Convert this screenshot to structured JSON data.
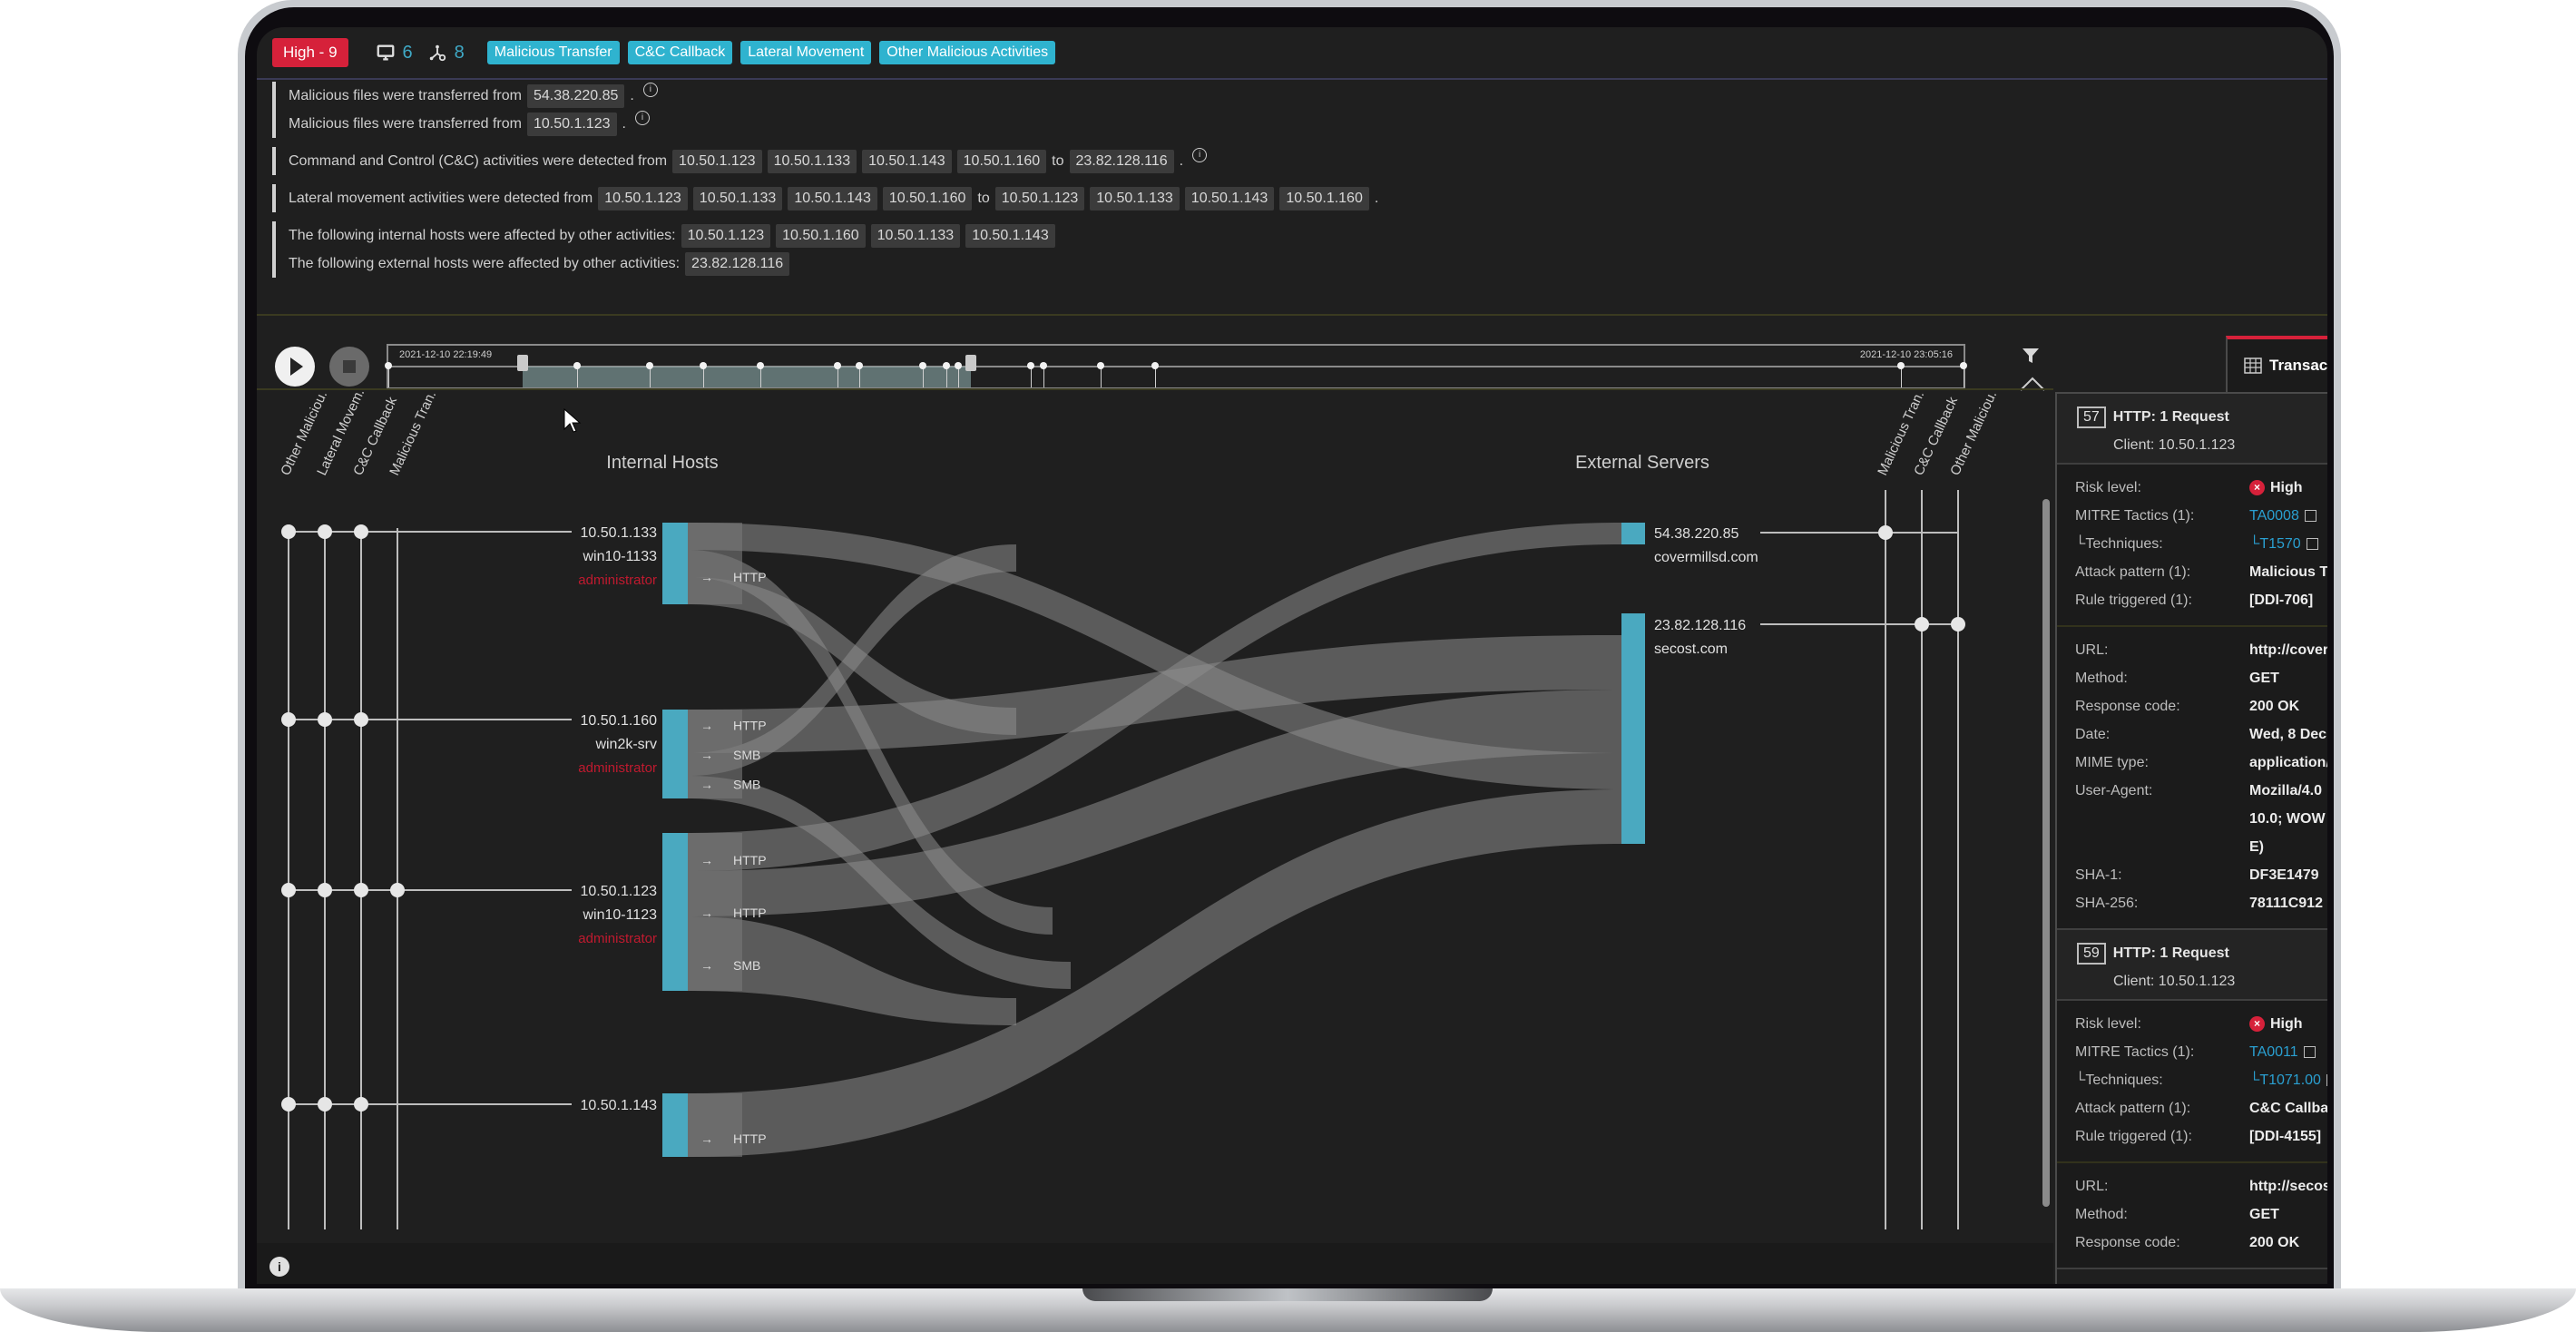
{
  "header": {
    "severity_badge": "High - 9",
    "hosts_count": "6",
    "connections_count": "8",
    "tags": [
      "Malicious Transfer",
      "C&C Callback",
      "Lateral Movement",
      "Other Malicious Activities"
    ]
  },
  "summary": {
    "transfer": [
      {
        "text": "Malicious files were transferred from",
        "ips": [
          "54.38.220.85"
        ],
        "suffix": "."
      },
      {
        "text": "Malicious files were transferred from",
        "ips": [
          "10.50.1.123"
        ],
        "suffix": "."
      }
    ],
    "cnc": {
      "text": "Command and Control (C&C) activities were detected from",
      "from": [
        "10.50.1.123",
        "10.50.1.133",
        "10.50.1.143",
        "10.50.1.160"
      ],
      "to_word": "to",
      "to": [
        "23.82.128.116"
      ],
      "suffix": "."
    },
    "lateral": {
      "text": "Lateral movement activities were detected from",
      "from": [
        "10.50.1.123",
        "10.50.1.133",
        "10.50.1.143",
        "10.50.1.160"
      ],
      "to_word": "to",
      "to": [
        "10.50.1.123",
        "10.50.1.133",
        "10.50.1.143",
        "10.50.1.160"
      ],
      "suffix": "."
    },
    "other_internal": {
      "text": "The following internal hosts were affected by other activities:",
      "ips": [
        "10.50.1.123",
        "10.50.1.160",
        "10.50.1.133",
        "10.50.1.143"
      ]
    },
    "other_external": {
      "text": "The following external hosts were affected by other activities:",
      "ips": [
        "23.82.128.116"
      ]
    }
  },
  "timeline": {
    "start_label": "2021-12-10 22:19:49",
    "end_label": "2021-12-10 23:05:16",
    "selected_range": [
      0.085,
      0.37
    ],
    "event_positions": [
      0.0,
      0.12,
      0.166,
      0.2,
      0.236,
      0.285,
      0.299,
      0.339,
      0.354,
      0.362,
      0.408,
      0.416,
      0.452,
      0.487,
      0.96,
      1.0
    ]
  },
  "graph": {
    "left_column_title": "Internal Hosts",
    "right_column_title": "External Servers",
    "left_category_labels": [
      "Other Maliciou.",
      "Lateral Movem.",
      "C&C Callback",
      "Malicious Tran."
    ],
    "right_category_labels": [
      "Malicious Tran.",
      "C&C Callback",
      "Other Maliciou."
    ],
    "internal_hosts": [
      {
        "ip": "10.50.1.133",
        "hostname": "win10-1133",
        "user": "administrator",
        "categories": [
          true,
          true,
          true,
          false
        ],
        "protocols": [
          "HTTP"
        ]
      },
      {
        "ip": "10.50.1.160",
        "hostname": "win2k-srv",
        "user": "administrator",
        "categories": [
          true,
          true,
          true,
          false
        ],
        "protocols": [
          "HTTP",
          "SMB",
          "SMB"
        ]
      },
      {
        "ip": "10.50.1.123",
        "hostname": "win10-1123",
        "user": "administrator",
        "categories": [
          true,
          true,
          true,
          true
        ],
        "protocols": [
          "HTTP",
          "HTTP",
          "SMB"
        ]
      },
      {
        "ip": "10.50.1.143",
        "hostname": "",
        "user": "",
        "categories": [
          true,
          true,
          true,
          false
        ],
        "protocols": [
          "HTTP"
        ]
      }
    ],
    "external_servers": [
      {
        "ip": "54.38.220.85",
        "domain": "covermillsd.com",
        "categories": [
          true,
          false,
          false
        ]
      },
      {
        "ip": "23.82.128.116",
        "domain": "secost.com",
        "categories": [
          false,
          true,
          true
        ]
      }
    ]
  },
  "side_panel": {
    "tab_label": "Transac",
    "cards": [
      {
        "number": "57",
        "title": "HTTP: 1 Request",
        "client": "Client: 10.50.1.123",
        "risk": [
          {
            "k": "Risk level:",
            "v": "High",
            "type": "risk"
          },
          {
            "k": "MITRE Tactics (1):",
            "v": "TA0008",
            "type": "link"
          },
          {
            "k": "└Techniques:",
            "v": "└T1570",
            "type": "link"
          },
          {
            "k": "Attack pattern (1):",
            "v": "Malicious T",
            "type": "text"
          },
          {
            "k": "Rule triggered (1):",
            "v": "[DDI-706]",
            "type": "text"
          }
        ],
        "details": [
          {
            "k": "URL:",
            "v": "http://cover"
          },
          {
            "k": "Method:",
            "v": "GET"
          },
          {
            "k": "Response code:",
            "v": "200 OK"
          },
          {
            "k": "Date:",
            "v": "Wed, 8 Dec"
          },
          {
            "k": "MIME type:",
            "v": "application/"
          },
          {
            "k": "User-Agent:",
            "v": "Mozilla/4.0"
          },
          {
            "k": "",
            "v": "10.0; WOW"
          },
          {
            "k": "",
            "v": "E)"
          },
          {
            "k": "SHA-1:",
            "v": "DF3E1479"
          },
          {
            "k": "SHA-256:",
            "v": "78111C912"
          }
        ]
      },
      {
        "number": "59",
        "title": "HTTP: 1 Request",
        "client": "Client: 10.50.1.123",
        "risk": [
          {
            "k": "Risk level:",
            "v": "High",
            "type": "risk"
          },
          {
            "k": "MITRE Tactics (1):",
            "v": "TA0011",
            "type": "link"
          },
          {
            "k": "└Techniques:",
            "v": "└T1071.00",
            "type": "link"
          },
          {
            "k": "Attack pattern (1):",
            "v": "C&C Callba",
            "type": "text"
          },
          {
            "k": "Rule triggered (1):",
            "v": "[DDI-4155]",
            "type": "text"
          }
        ],
        "details": [
          {
            "k": "URL:",
            "v": "http://secos"
          },
          {
            "k": "Method:",
            "v": "GET"
          },
          {
            "k": "Response code:",
            "v": "200 OK"
          }
        ]
      }
    ]
  },
  "colors": {
    "accent": "#2fb3cf",
    "severity": "#d6213a",
    "link": "#2a9fd0",
    "node": "#4aa9c0",
    "flow": "#8a8a8a"
  },
  "icons": {
    "hosts": "monitor-icon",
    "connections": "network-icon",
    "filter": "funnel-icon",
    "tab": "table-icon",
    "info": "info-icon"
  }
}
